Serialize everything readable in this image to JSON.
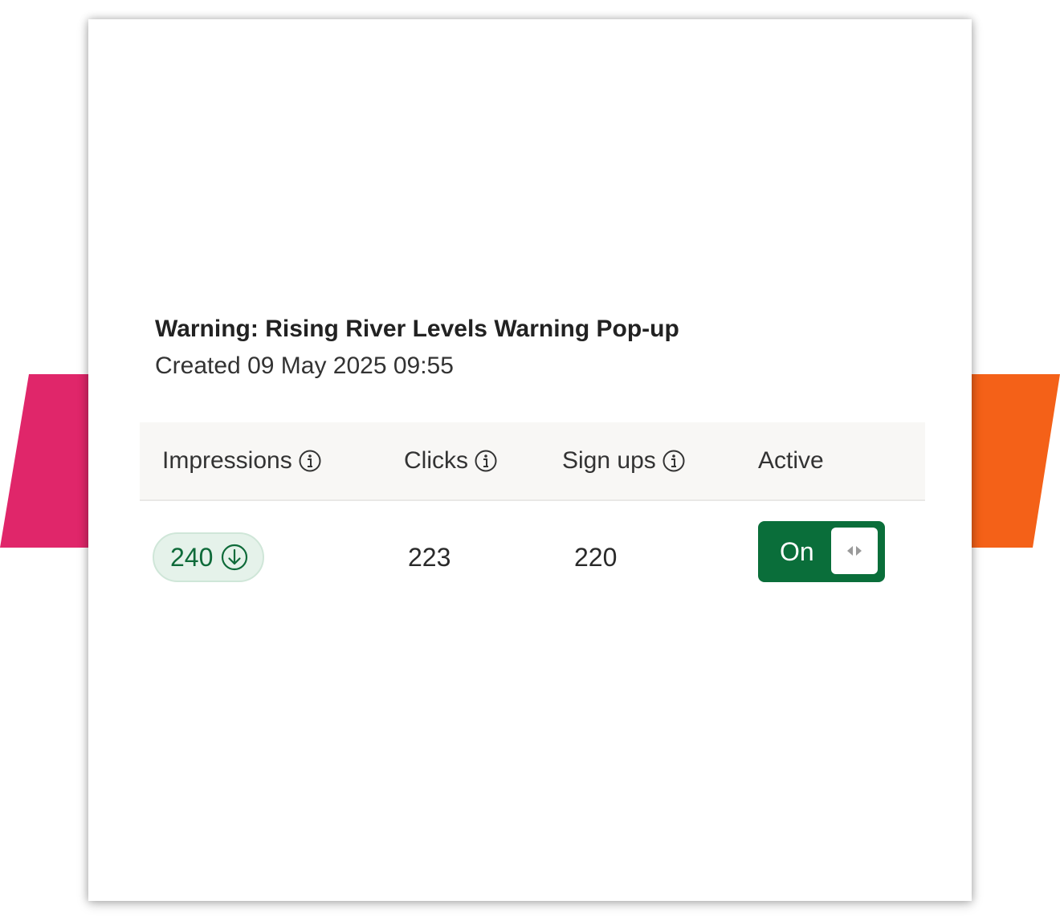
{
  "campaign": {
    "title": "Warning: Rising River Levels Warning Pop-up",
    "created": "Created 09 May 2025 09:55"
  },
  "table": {
    "headers": {
      "impressions": "Impressions",
      "clicks": "Clicks",
      "signups": "Sign ups",
      "active": "Active"
    },
    "row": {
      "impressions": "240",
      "clicks": "223",
      "signups": "220",
      "active_label": "On"
    }
  },
  "icons": {
    "info": "info-icon",
    "sort": "arrow-down-circle-icon",
    "toggle_knob": "toggle-handle-icon"
  },
  "colors": {
    "accent_green": "#0a6e3a",
    "pill_bg": "#e5f2ea",
    "header_bg": "#f8f7f5",
    "decor_pink": "#e0266a",
    "decor_orange": "#f46118"
  }
}
